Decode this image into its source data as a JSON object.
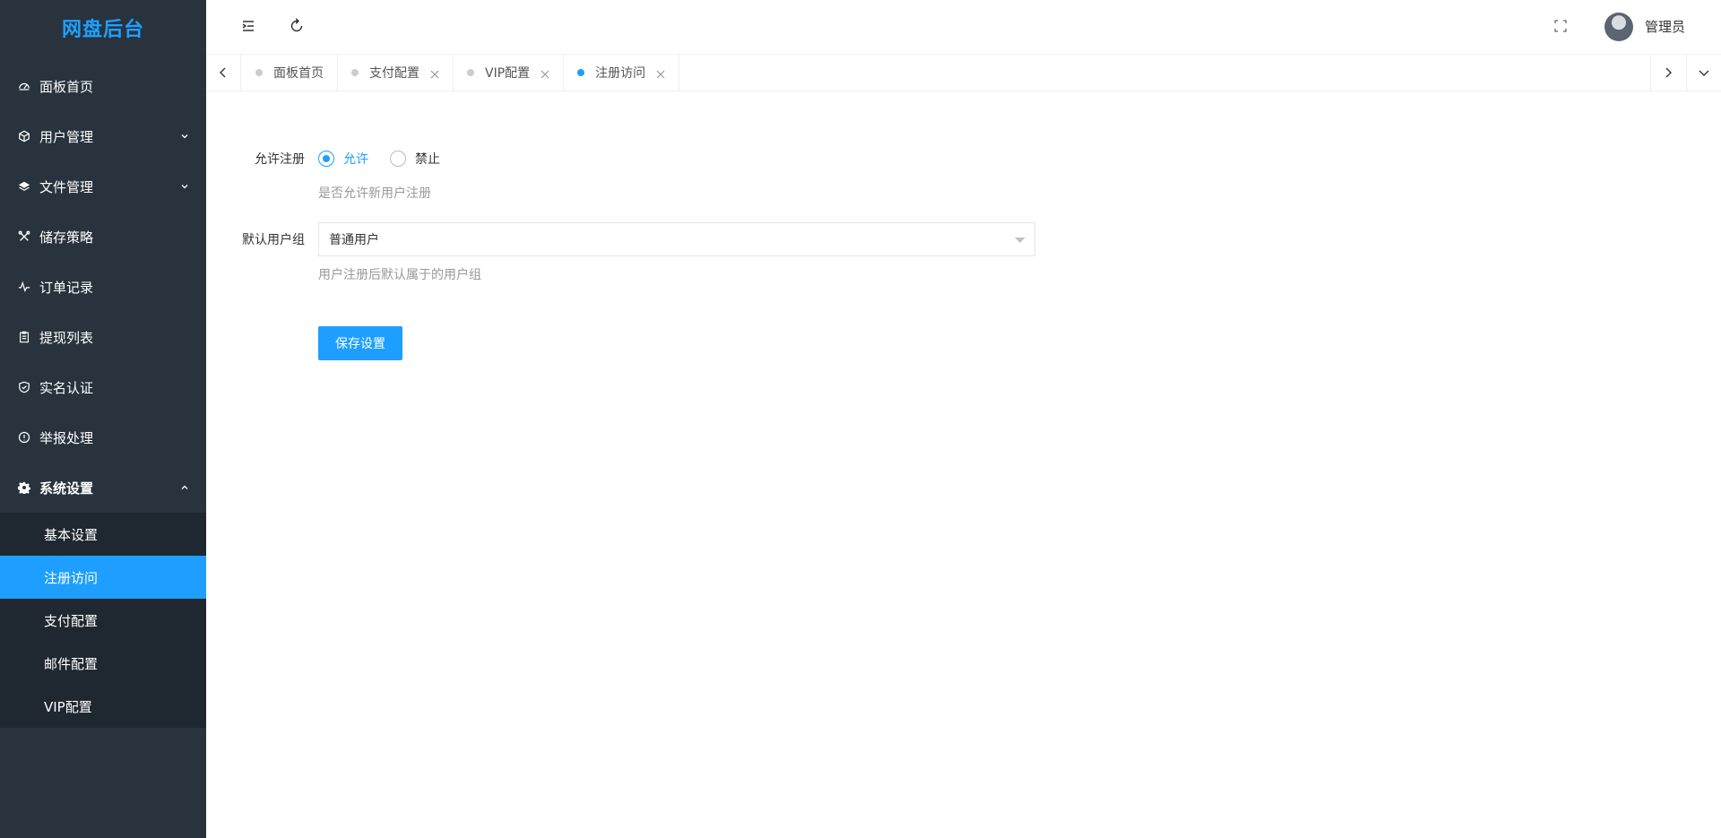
{
  "colors": {
    "accent": "#1e9fff",
    "sidebar_bg": "#28333e",
    "submenu_bg": "#1f2730"
  },
  "sidebar": {
    "logo": "网盘后台",
    "items": [
      {
        "label": "面板首页",
        "icon": "dashboard-icon"
      },
      {
        "label": "用户管理",
        "icon": "cube-icon"
      },
      {
        "label": "文件管理",
        "icon": "layers-icon"
      },
      {
        "label": "储存策略",
        "icon": "tools-icon"
      },
      {
        "label": "订单记录",
        "icon": "pulse-icon"
      },
      {
        "label": "提现列表",
        "icon": "clipboard-icon"
      },
      {
        "label": "实名认证",
        "icon": "shield-icon"
      },
      {
        "label": "举报处理",
        "icon": "info-icon"
      },
      {
        "label": "系统设置",
        "icon": "gear-icon"
      }
    ],
    "submenu": [
      "基本设置",
      "注册访问",
      "支付配置",
      "邮件配置",
      "VIP配置"
    ]
  },
  "header": {
    "admin_name": "管理员"
  },
  "tabs": [
    "面板首页",
    "支付配置",
    "VIP配置",
    "注册访问"
  ],
  "form": {
    "register_label": "允许注册",
    "allow_label": "允许",
    "deny_label": "禁止",
    "register_help": "是否允许新用户注册",
    "group_label": "默认用户组",
    "group_value": "普通用户",
    "group_help": "用户注册后默认属于的用户组",
    "save_label": "保存设置"
  }
}
